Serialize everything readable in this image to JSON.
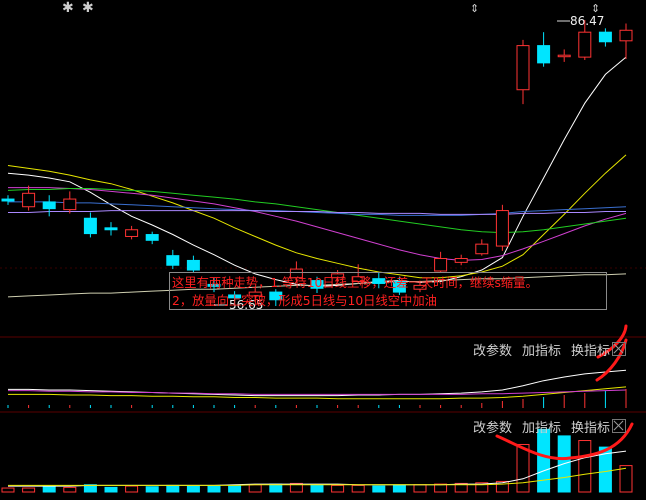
{
  "chart_data": {
    "type": "candlestick",
    "price_high_label": "86.47",
    "price_low_label": "56.65",
    "candles": [
      {
        "o": 67.8,
        "c": 67.6,
        "h": 68.2,
        "l": 67.2
      },
      {
        "o": 67.0,
        "c": 68.4,
        "h": 69.2,
        "l": 66.6
      },
      {
        "o": 67.5,
        "c": 66.8,
        "h": 68.2,
        "l": 66.0
      },
      {
        "o": 66.7,
        "c": 67.8,
        "h": 68.6,
        "l": 66.3
      },
      {
        "o": 65.8,
        "c": 64.2,
        "h": 66.4,
        "l": 63.8
      },
      {
        "o": 64.8,
        "c": 64.6,
        "h": 65.4,
        "l": 64.0
      },
      {
        "o": 63.9,
        "c": 64.6,
        "h": 65.0,
        "l": 63.6
      },
      {
        "o": 64.1,
        "c": 63.5,
        "h": 64.4,
        "l": 63.1
      },
      {
        "o": 61.9,
        "c": 60.9,
        "h": 62.5,
        "l": 60.5
      },
      {
        "o": 61.4,
        "c": 60.4,
        "h": 61.9,
        "l": 60.1
      },
      {
        "o": 58.9,
        "c": 58.7,
        "h": 59.6,
        "l": 58.1
      },
      {
        "o": 57.8,
        "c": 57.5,
        "h": 58.2,
        "l": 56.9
      },
      {
        "o": 57.7,
        "c": 58.1,
        "h": 58.6,
        "l": 57.2
      },
      {
        "o": 58.1,
        "c": 57.3,
        "h": 58.4,
        "l": 56.65
      },
      {
        "o": 59.6,
        "c": 60.5,
        "h": 61.3,
        "l": 59.1
      },
      {
        "o": 59.3,
        "c": 58.5,
        "h": 59.7,
        "l": 58.0
      },
      {
        "o": 59.6,
        "c": 60.0,
        "h": 60.4,
        "l": 59.3
      },
      {
        "o": 59.2,
        "c": 59.7,
        "h": 61.0,
        "l": 59.0
      },
      {
        "o": 59.5,
        "c": 59.0,
        "h": 60.1,
        "l": 58.5
      },
      {
        "o": 59.2,
        "c": 58.1,
        "h": 59.7,
        "l": 57.8
      },
      {
        "o": 58.4,
        "c": 58.8,
        "h": 59.3,
        "l": 58.1
      },
      {
        "o": 60.3,
        "c": 61.6,
        "h": 62.3,
        "l": 60.1
      },
      {
        "o": 61.2,
        "c": 61.6,
        "h": 62.0,
        "l": 60.9
      },
      {
        "o": 62.1,
        "c": 63.1,
        "h": 63.6,
        "l": 61.9
      },
      {
        "o": 62.9,
        "c": 66.6,
        "h": 67.2,
        "l": 62.4
      },
      {
        "o": 79.2,
        "c": 83.8,
        "h": 84.4,
        "l": 77.7
      },
      {
        "o": 83.8,
        "c": 82.0,
        "h": 85.2,
        "l": 81.6
      },
      {
        "o": 82.7,
        "c": 82.8,
        "h": 83.4,
        "l": 82.1
      },
      {
        "o": 82.6,
        "c": 85.2,
        "h": 86.47,
        "l": 82.3
      },
      {
        "o": 85.2,
        "c": 84.2,
        "h": 85.6,
        "l": 83.7
      },
      {
        "o": 84.3,
        "c": 85.4,
        "h": 86.1,
        "l": 82.4
      }
    ],
    "ma_lines": [
      {
        "color": "#ffffff",
        "values": [
          70.5,
          70.3,
          70.0,
          69.6,
          68.5,
          67.2,
          66.0,
          65.1,
          64.1,
          63.0,
          62.0,
          60.9,
          60.0,
          59.4,
          58.9,
          58.7,
          58.8,
          59.0,
          59.2,
          59.3,
          59.1,
          59.2,
          59.7,
          60.4,
          61.7,
          66.0,
          70.0,
          74.0,
          77.8,
          80.8,
          82.6
        ]
      },
      {
        "color": "#e6e600",
        "values": [
          71.3,
          71.0,
          70.7,
          70.3,
          69.8,
          69.4,
          68.8,
          68.1,
          67.4,
          66.6,
          65.8,
          64.8,
          63.9,
          63.0,
          62.2,
          61.6,
          61.1,
          60.6,
          60.2,
          59.9,
          59.6,
          59.6,
          59.8,
          60.2,
          60.8,
          62.0,
          64.1,
          66.2,
          68.4,
          70.5,
          72.4
        ]
      },
      {
        "color": "#d040d0",
        "values": [
          69.0,
          69.0,
          69.0,
          68.9,
          68.8,
          68.6,
          68.4,
          68.2,
          67.9,
          67.6,
          67.3,
          66.9,
          66.5,
          66.0,
          65.5,
          64.9,
          64.3,
          63.7,
          63.1,
          62.5,
          62.0,
          61.6,
          61.4,
          61.5,
          61.9,
          62.6,
          63.4,
          64.2,
          65.0,
          65.7,
          66.3
        ]
      },
      {
        "color": "#22cc22",
        "values": [
          68.7,
          68.8,
          68.8,
          68.9,
          68.9,
          68.8,
          68.7,
          68.6,
          68.4,
          68.2,
          68.0,
          67.8,
          67.5,
          67.3,
          67.0,
          66.7,
          66.4,
          66.1,
          65.8,
          65.5,
          65.2,
          64.9,
          64.6,
          64.4,
          64.3,
          64.4,
          64.6,
          64.9,
          65.2,
          65.5,
          65.8
        ]
      },
      {
        "color": "#3a6fd0",
        "values": [
          67.5,
          67.5,
          67.5,
          67.4,
          67.4,
          67.3,
          67.2,
          67.1,
          67.0,
          66.9,
          66.8,
          66.7,
          66.6,
          66.6,
          66.5,
          66.4,
          66.3,
          66.2,
          66.2,
          66.1,
          66.1,
          66.1,
          66.1,
          66.2,
          66.3,
          66.5,
          66.6,
          66.7,
          66.8,
          66.9,
          67.0
        ]
      },
      {
        "color": "#aa88ff",
        "values": [
          66.4,
          66.4,
          66.5,
          66.5,
          66.5,
          66.6,
          66.6,
          66.6,
          66.6,
          66.6,
          66.6,
          66.6,
          66.6,
          66.5,
          66.5,
          66.5,
          66.4,
          66.4,
          66.3,
          66.3,
          66.3,
          66.2,
          66.2,
          66.2,
          66.2,
          66.3,
          66.3,
          66.4,
          66.4,
          66.5,
          66.5
        ]
      },
      {
        "color": "#cfcfb0",
        "values": [
          57.6,
          57.7,
          57.8,
          57.9,
          58.0,
          58.0,
          58.1,
          58.2,
          58.3,
          58.4,
          58.4,
          58.5,
          58.6,
          58.7,
          58.8,
          58.8,
          58.9,
          59.0,
          59.1,
          59.2,
          59.2,
          59.3,
          59.4,
          59.5,
          59.5,
          59.6,
          59.7,
          59.8,
          59.9,
          59.9,
          60.0
        ]
      }
    ],
    "indicator1": {
      "lines": [
        {
          "color": "#ffffff",
          "values": [
            30,
            30,
            29,
            29,
            28,
            27,
            26,
            25,
            24,
            23,
            22,
            21,
            20,
            20,
            20,
            20,
            20,
            21,
            21,
            22,
            22,
            23,
            24,
            26,
            29,
            36,
            44,
            50,
            55,
            58,
            61
          ]
        },
        {
          "color": "#e6e600",
          "values": [
            22,
            22,
            22,
            21,
            21,
            20,
            20,
            19,
            19,
            18,
            18,
            17,
            17,
            16,
            16,
            16,
            15,
            15,
            15,
            15,
            15,
            15,
            16,
            16,
            17,
            19,
            22,
            25,
            28,
            31,
            34
          ]
        },
        {
          "color": "#d040d0",
          "values": [
            28,
            28,
            27,
            27,
            26,
            26,
            25,
            25,
            24,
            24,
            23,
            23,
            22,
            22,
            22,
            22,
            22,
            22,
            22,
            22,
            22,
            22,
            22,
            23,
            23,
            24,
            25,
            26,
            27,
            28,
            29
          ]
        }
      ]
    },
    "indicator2": {
      "volumes": [
        6,
        6,
        8,
        7,
        11,
        7,
        9,
        8,
        10,
        9,
        9,
        10,
        11,
        12,
        13,
        11,
        10,
        10,
        9,
        10,
        11,
        12,
        13,
        14,
        16,
        72,
        95,
        85,
        78,
        68,
        40
      ],
      "colors": [
        "r",
        "r",
        "c",
        "r",
        "c",
        "c",
        "r",
        "c",
        "c",
        "c",
        "c",
        "c",
        "r",
        "c",
        "r",
        "c",
        "r",
        "r",
        "c",
        "c",
        "r",
        "r",
        "r",
        "r",
        "r",
        "r",
        "c",
        "c",
        "r",
        "c",
        "r"
      ],
      "lines": [
        {
          "color": "#ffffff",
          "values": [
            9,
            9,
            9,
            9,
            10,
            10,
            10,
            10,
            10,
            10,
            10,
            11,
            12,
            12,
            12,
            12,
            12,
            11,
            11,
            11,
            11,
            11,
            12,
            12,
            14,
            20,
            32,
            43,
            52,
            58,
            62
          ]
        },
        {
          "color": "#e6e600",
          "values": [
            10,
            10,
            10,
            10,
            10,
            10,
            10,
            10,
            10,
            10,
            10,
            10,
            11,
            11,
            11,
            11,
            11,
            11,
            11,
            11,
            11,
            11,
            11,
            11,
            12,
            14,
            18,
            22,
            27,
            31,
            36
          ]
        }
      ]
    }
  },
  "panel1": {
    "btn_params": "改参数",
    "btn_add": "加指标",
    "btn_swap": "换指标"
  },
  "panel2": {
    "btn_params": "改参数",
    "btn_add": "加指标",
    "btn_swap": "换指标"
  },
  "note": {
    "line1": "这里有两种走势，1.等待10日线上移，还差一天时间，继续s缩量。",
    "line2": "2，放量向上突破，形成5日线与10日线空中加油"
  },
  "colors": {
    "up": "#ff3333",
    "down": "#00e5ff",
    "annot": "#ff1a1a"
  }
}
